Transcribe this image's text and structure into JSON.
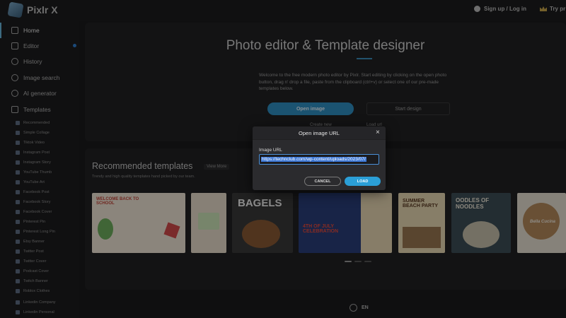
{
  "app": {
    "name": "Pixlr X"
  },
  "topbar": {
    "signup_label": "Sign up / Log in",
    "trypro_label": "Try pr"
  },
  "sidebar": {
    "items": [
      {
        "label": "Home",
        "icon": "home-icon"
      },
      {
        "label": "Editor",
        "icon": "editor-icon"
      },
      {
        "label": "History",
        "icon": "history-icon"
      },
      {
        "label": "Image search",
        "icon": "image-search-icon"
      },
      {
        "label": "AI generator",
        "icon": "ai-generator-icon"
      },
      {
        "label": "Templates",
        "icon": "templates-icon"
      }
    ],
    "templates": [
      "Recommended",
      "Simple Collage",
      "Tiktok Video",
      "Instagram Post",
      "Instagram Story",
      "YouTube Thumb",
      "YouTube Art",
      "Facebook Post",
      "Facebook Story",
      "Facebook Cover",
      "Pinterest Pin",
      "Pinterest Long Pin",
      "Etsy Banner",
      "Twitter Post",
      "Twitter Cover",
      "Podcast Cover",
      "Twitch Banner",
      "Roblox Clothes",
      "Linkedin Company",
      "Linkedin Personal"
    ]
  },
  "hero": {
    "title": "Photo editor & Template designer",
    "description": "Welcome to the free modern photo editor by Pixlr. Start editing by clicking on the open photo button, drag n' drop a file, paste from the clipboard (ctrl+v) or select one of our pre-made templates below.",
    "open_label": "Open image",
    "start_label": "Start design",
    "create_new": "Create new",
    "load_url": "Load url"
  },
  "recommended": {
    "title": "Recommended templates",
    "view_more": "View More",
    "subtitle": "Trendy and high quality templates hand picked by our team.",
    "cards": [
      "WELCOME BACK TO SCHOOL",
      "",
      "BAGELS",
      "4TH OF JULY CELEBRATION",
      "SUMMER BEACH PARTY",
      "OODLES OF NOODLES",
      "Bella Cucina"
    ]
  },
  "footer": {
    "language": "EN"
  },
  "modal": {
    "title": "Open image URL",
    "close_label": "×",
    "field_label": "Image URL",
    "url_value": "https://technclub.com/wp-content/uploads/2023/07/",
    "cancel_label": "CANCEL",
    "load_label": "LOAD"
  },
  "colors": {
    "accent": "#2b9fd7",
    "selection": "#3d78d6"
  }
}
